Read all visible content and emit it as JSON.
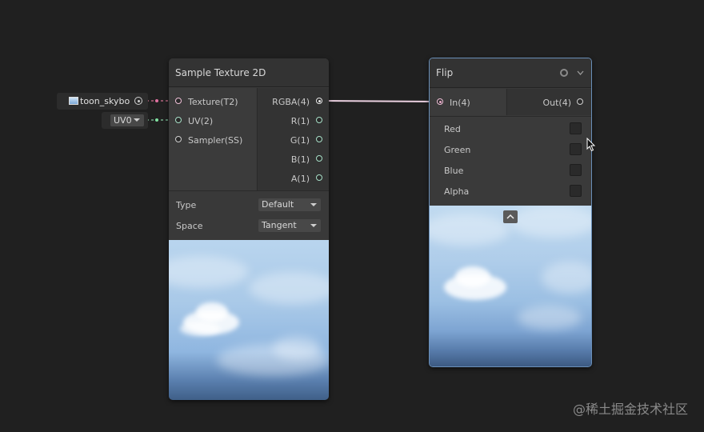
{
  "colors": {
    "background": "#202020",
    "node_body": "#393939",
    "node_header": "#333333",
    "wire_texture": "#e8b0c8",
    "wire_vector": "#a8e0c8",
    "selection_outline": "#6a8fb8"
  },
  "sample_texture_node": {
    "title": "Sample Texture 2D",
    "inputs": [
      {
        "label": "Texture(T2)"
      },
      {
        "label": "UV(2)"
      },
      {
        "label": "Sampler(SS)"
      }
    ],
    "outputs": [
      {
        "label": "RGBA(4)"
      },
      {
        "label": "R(1)"
      },
      {
        "label": "G(1)"
      },
      {
        "label": "B(1)"
      },
      {
        "label": "A(1)"
      }
    ],
    "type_label": "Type",
    "type_value": "Default",
    "space_label": "Space",
    "space_value": "Tangent"
  },
  "texture_input": {
    "label": "toon_skybo",
    "icon": "texture-icon",
    "picker_icon": "object-picker-icon"
  },
  "uv_input": {
    "value": "UV0"
  },
  "flip_node": {
    "title": "Flip",
    "input_label": "In(4)",
    "output_label": "Out(4)",
    "settings_icon": "gear-icon",
    "collapse_icon": "chevron-down-icon",
    "toggles": [
      {
        "label": "Red",
        "checked": false
      },
      {
        "label": "Green",
        "checked": false
      },
      {
        "label": "Blue",
        "checked": false
      },
      {
        "label": "Alpha",
        "checked": false
      }
    ],
    "preview_toggle_icon": "chevron-up-icon"
  },
  "watermark": "@稀土掘金技术社区"
}
